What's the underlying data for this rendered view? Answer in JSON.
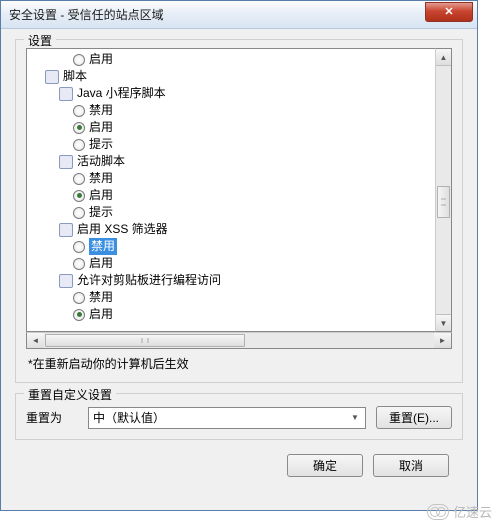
{
  "titlebar": {
    "text": "安全设置 - 受信任的站点区域"
  },
  "settings_group": {
    "title": "设置"
  },
  "tree": {
    "row_enable_top": "启用",
    "cat_script": "脚本",
    "cat_java_applet": "Java 小程序脚本",
    "opt_disable": "禁用",
    "opt_enable": "启用",
    "opt_prompt": "提示",
    "cat_active_script": "活动脚本",
    "cat_xss": "启用 XSS 筛选器",
    "cat_clipboard": "允许对剪贴板进行编程访问"
  },
  "note": "*在重新启动你的计算机后生效",
  "reset_group": {
    "title": "重置自定义设置"
  },
  "reset": {
    "label": "重置为",
    "combo_value": "中（默认值）",
    "button": "重置(E)..."
  },
  "actions": {
    "ok": "确定",
    "cancel": "取消"
  },
  "watermark": "亿速云"
}
